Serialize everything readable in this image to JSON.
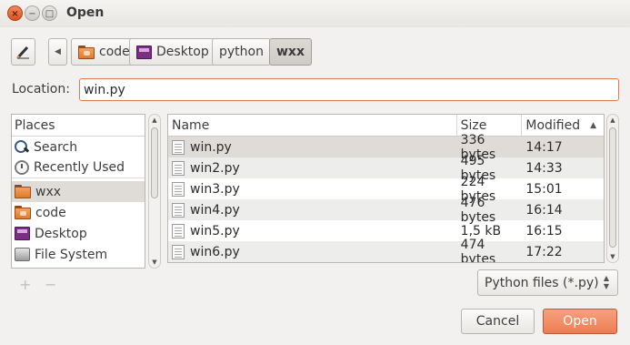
{
  "window": {
    "title": "Open",
    "close_glyph": "×",
    "min_glyph": "−",
    "max_glyph": "□"
  },
  "pathbar": {
    "arrow_glyph": "◀",
    "crumbs": [
      {
        "label": "code",
        "icon": "folder-icon"
      },
      {
        "label": "Desktop",
        "icon": "desktop-icon"
      },
      {
        "label": "python",
        "icon": ""
      },
      {
        "label": "wxx",
        "icon": ""
      }
    ]
  },
  "location": {
    "label": "Location:",
    "value": "win.py"
  },
  "places": {
    "header": "Places",
    "items": [
      {
        "label": "Search",
        "icon": "search-icon"
      },
      {
        "label": "Recently Used",
        "icon": "clock-icon"
      },
      {
        "label": "wxx",
        "icon": "folder-icon"
      },
      {
        "label": "code",
        "icon": "folder-icon"
      },
      {
        "label": "Desktop",
        "icon": "desktop-icon"
      },
      {
        "label": "File System",
        "icon": "drive-icon"
      }
    ],
    "add_glyph": "+",
    "remove_glyph": "−"
  },
  "files": {
    "columns": {
      "name": "Name",
      "size": "Size",
      "modified": "Modified"
    },
    "sort_glyph": "▲",
    "rows": [
      {
        "name": "win.py",
        "size": "336 bytes",
        "modified": "14:17"
      },
      {
        "name": "win2.py",
        "size": "495 bytes",
        "modified": "14:33"
      },
      {
        "name": "win3.py",
        "size": "224 bytes",
        "modified": "15:01"
      },
      {
        "name": "win4.py",
        "size": "476 bytes",
        "modified": "16:14"
      },
      {
        "name": "win5.py",
        "size": "1,5 kB",
        "modified": "16:15"
      },
      {
        "name": "win6.py",
        "size": "474 bytes",
        "modified": "17:22"
      }
    ]
  },
  "filter": {
    "value": "Python files (*.py)"
  },
  "buttons": {
    "cancel": "Cancel",
    "open": "Open"
  },
  "colors": {
    "accent": "#ee7d53",
    "selection": "#dfdcd8"
  }
}
